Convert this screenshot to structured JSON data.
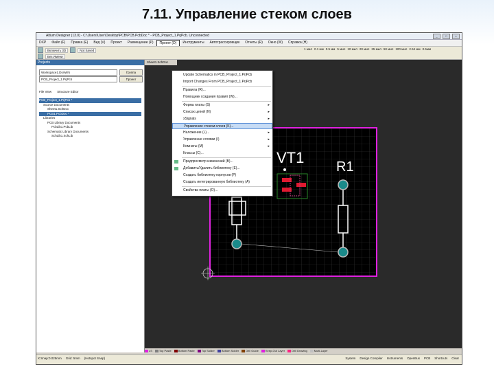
{
  "slide_title": "7.11. Управление стеком слоев",
  "app": {
    "window_title": "Altium Designer (13.0) - C:\\Users\\User\\Desktop\\PCB\\PCB.PcbDoc * - PCB_Project_1.PrjPcb. Unconnected",
    "menubar": [
      "DXP",
      "Файл (F)",
      "Правка (E)",
      "Вид (V)",
      "Проект",
      "Размещение (P)",
      "Проект (D)",
      "Инструменты",
      "Автотрассировщик",
      "Отчеты (R)",
      "Окно (W)",
      "Справка (H)"
    ],
    "active_menu_index": 6,
    "toolbar": {
      "row1_left": [
        "Включить 3D",
        "Not Saved"
      ],
      "row1_right": [
        "1 мил",
        "0.1 мм",
        "0.5 мм",
        "5 мил",
        "10 мил",
        "20 мил",
        "25 мил",
        "50 мил",
        "100 мил",
        "2.54 мм",
        "0.5мм"
      ],
      "row2": [
        "Без Имени"
      ]
    },
    "projects_panel": {
      "header": "Projects",
      "workspace_box": "Workspace1.DsnWrk",
      "workspace_btn": "Группа",
      "project_box": "PCB_Project_1.PrjPcb",
      "project_btn": "Проект",
      "view_opts": [
        "File View",
        "Structure Editor"
      ],
      "tree": [
        {
          "text": "PCB_Project_1.PrjPcb *",
          "sel": true
        },
        {
          "text": "Source Documents",
          "sel": false
        },
        {
          "text": "Sheet1.SchDoc",
          "sel": false
        },
        {
          "text": "PCB1.PcbDoc *",
          "sel": true
        },
        {
          "text": "Libraries",
          "sel": false
        },
        {
          "text": "PCB Library Documents",
          "sel": false
        },
        {
          "text": "PcbLib1.PcbLib",
          "sel": false
        },
        {
          "text": "Schematic Library Documents",
          "sel": false
        },
        {
          "text": "SchLib1.SchLib",
          "sel": false
        }
      ]
    },
    "doc_tab": "Sheet1.SchDoc",
    "menu_items": [
      {
        "label": "Update Schematics in PCB_Project_1.PrjPcb",
        "arrow": false,
        "icon": false
      },
      {
        "label": "Import Changes From PCB_Project_1.PrjPcb",
        "arrow": false,
        "icon": false
      },
      {
        "label": "Правила (R)...",
        "arrow": false,
        "icon": false
      },
      {
        "label": "Помощник создания правил (W)...",
        "arrow": false,
        "icon": false
      },
      {
        "label": "Форма платы (S)",
        "arrow": true,
        "icon": false
      },
      {
        "label": "Список цепей (N)",
        "arrow": true,
        "icon": false
      },
      {
        "label": "xSignals",
        "arrow": true,
        "icon": false
      },
      {
        "label": "Управление стеком слоев (K)...",
        "arrow": false,
        "icon": false,
        "hl": true
      },
      {
        "label": "Наложение (L)...",
        "arrow": true,
        "icon": false
      },
      {
        "label": "Управление слоями (I)",
        "arrow": true,
        "icon": false
      },
      {
        "label": "Комнаты (M)",
        "arrow": true,
        "icon": false
      },
      {
        "label": "Классы (C)...",
        "arrow": false,
        "icon": false
      },
      {
        "label": "Предпросмотр изменений (B)...",
        "arrow": false,
        "icon": true
      },
      {
        "label": "Добавить/Удалить библиотеку (E)...",
        "arrow": false,
        "icon": true
      },
      {
        "label": "Создать библиотеку корпусов (P)",
        "arrow": false,
        "icon": false
      },
      {
        "label": "Создать интегрированную библиотеку (A)",
        "arrow": false,
        "icon": false
      },
      {
        "label": "Свойства платы (O)...",
        "arrow": false,
        "icon": false
      }
    ],
    "board": {
      "vt1_label": "VT1",
      "r1_label": "R1",
      "outline_color": "#e020e0",
      "pad_color": "#1a8a8a",
      "red": "#e01a30"
    },
    "layer_tabs": [
      {
        "name": "LS",
        "color": "#e020e0"
      },
      {
        "name": "Top Paste",
        "color": "#808080"
      },
      {
        "name": "Bottom Paste",
        "color": "#800000"
      },
      {
        "name": "Top Solder",
        "color": "#800080"
      },
      {
        "name": "Bottom Solder",
        "color": "#4040a0"
      },
      {
        "name": "Drill Guide",
        "color": "#804000"
      },
      {
        "name": "Keep-Out Layer",
        "color": "#e020e0"
      },
      {
        "name": "Drill Drawing",
        "color": "#ff2080"
      },
      {
        "name": "Multi-Layer",
        "color": "#c0c0c0"
      }
    ],
    "status_left": [
      "X:Snap:0.025mm",
      "Grid: 5mm",
      "(Hotspot Snap)"
    ],
    "status_right": [
      "System",
      "Design Compiler",
      "Instruments",
      "OpenBus",
      "PCB",
      "Shortcuts",
      "Clear"
    ]
  }
}
